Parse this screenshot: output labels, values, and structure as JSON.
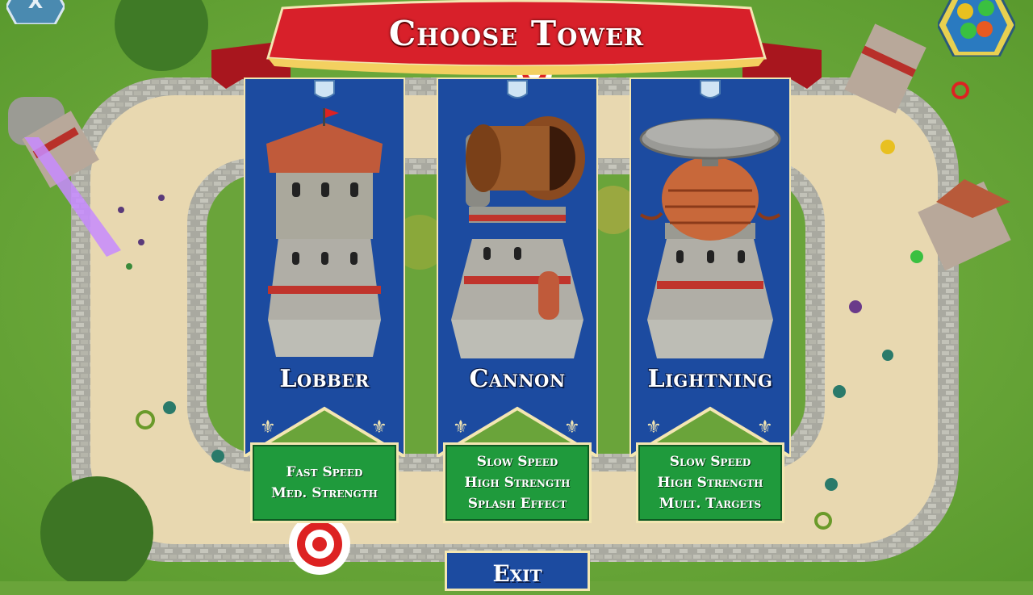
{
  "title": "Choose Tower",
  "towers": [
    {
      "name": "Lobber",
      "stats": [
        "Fast Speed",
        "Med. Strength"
      ]
    },
    {
      "name": "Cannon",
      "stats": [
        "Slow Speed",
        "High Strength",
        "Splash Effect"
      ]
    },
    {
      "name": "Lightning",
      "stats": [
        "Slow Speed",
        "High Strength",
        "Mult. Targets"
      ]
    }
  ],
  "exit_label": "Exit",
  "colors": {
    "banner_blue": "#1c4ba0",
    "stats_green": "#1f9a3c",
    "ribbon_red": "#d8202a",
    "trim_gold": "#f3e6b2",
    "grass": "#6aa43a",
    "path_sand": "#e8d8b0"
  },
  "icons": [
    "close-x-icon",
    "color-palette-icon",
    "shield-crest-icon",
    "fleur-de-lis-icon"
  ]
}
